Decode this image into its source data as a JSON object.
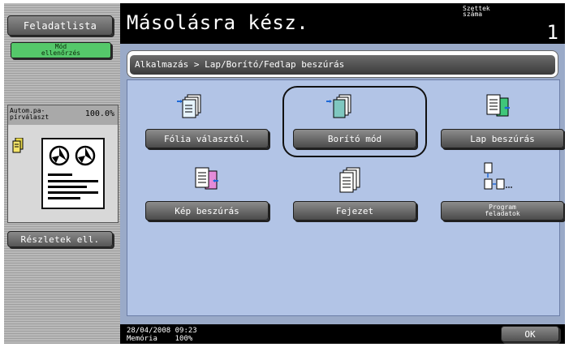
{
  "left_panel": {
    "job_list_label": "Feladatlista",
    "check_mode_label_line1": "Mód",
    "check_mode_label_line2": "ellenőrzés",
    "preview_label_line1": "Autom.pa-",
    "preview_label_line2": "pírválaszt",
    "zoom": "100.0%",
    "details_label": "Részletek ell."
  },
  "header": {
    "title": "Másolásra kész.",
    "sets_label_line1": "Szettek",
    "sets_label_line2": "száma",
    "sets_value": "1"
  },
  "breadcrumb": "Alkalmazás > Lap/Borító/Fedlap beszúrás",
  "functions": [
    {
      "label": "Fólia választól.",
      "icon": "transparency-sheets-icon"
    },
    {
      "label": "Borító mód",
      "icon": "cover-mode-icon",
      "selected": true
    },
    {
      "label": "Lap beszúrás",
      "icon": "insert-sheet-icon"
    },
    {
      "label": "Kép beszúrás",
      "icon": "insert-image-icon"
    },
    {
      "label": "Fejezet",
      "icon": "chapter-icon"
    },
    {
      "label_line1": "Program",
      "label_line2": "feladatok",
      "icon": "program-jobs-icon"
    }
  ],
  "status": {
    "datetime": "28/04/2008   09:23",
    "memory_label": "Memória",
    "memory_value": "100%"
  },
  "ok_label": "OK",
  "colors": {
    "main_bg": "#9aaac8",
    "panel_bg": "#b2c4e6",
    "check_mode_green": "#55c86a"
  }
}
